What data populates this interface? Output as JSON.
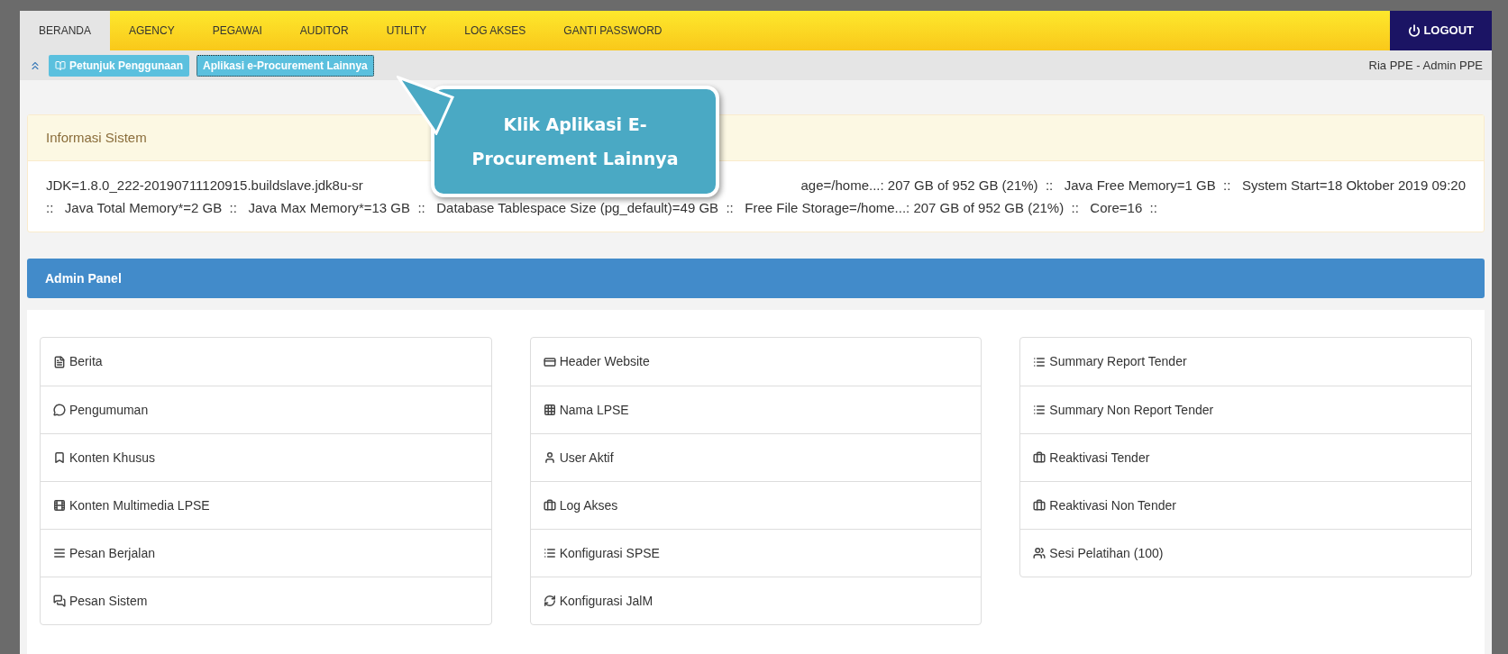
{
  "nav": {
    "tabs": [
      {
        "label": "BERANDA",
        "selected": true
      },
      {
        "label": "AGENCY",
        "selected": false
      },
      {
        "label": "PEGAWAI",
        "selected": false
      },
      {
        "label": "AUDITOR",
        "selected": false
      },
      {
        "label": "UTILITY",
        "selected": false
      },
      {
        "label": "LOG AKSES",
        "selected": false
      },
      {
        "label": "GANTI PASSWORD",
        "selected": false
      }
    ],
    "logout": "LOGOUT"
  },
  "toolbar": {
    "buttons": [
      {
        "label": "Petunjuk Penggunaan",
        "focused": false
      },
      {
        "label": "Aplikasi e-Procurement Lainnya",
        "focused": true
      }
    ],
    "user": "Ria PPE - Admin PPE"
  },
  "callout": {
    "lines": [
      "Klik Aplikasi E-",
      "Procurement Lainnya"
    ]
  },
  "info_panel": {
    "title": "Informasi Sistem",
    "line_1_start": "JDK=1.8.0_222-20190711120915.buildslave.jdk8u-sr",
    "line_1_end": "age=/home...: 207 GB of 952 GB (21%)  ::   Java Free Memory=1 GB  ::   System Start=18 Oktober 2019 09:20",
    "line_2": "::   Java Total Memory*=2 GB  ::   Java Max Memory*=13 GB  ::   Database Tablespace Size (pg_default)=49 GB  ::   Free File Storage=/home...: 207 GB of 952 GB (21%)  ::   Core=16  ::"
  },
  "admin_panel": {
    "title": "Admin Panel",
    "columns": [
      [
        "Berita",
        "Pengumuman",
        "Konten Khusus",
        "Konten Multimedia LPSE",
        "Pesan Berjalan",
        "Pesan Sistem"
      ],
      [
        "Header Website",
        "Nama LPSE",
        "User Aktif",
        "Log Akses",
        "Konfigurasi SPSE",
        "Konfigurasi JalM"
      ],
      [
        "Summary Report Tender",
        "Summary Non Report Tender",
        "Reaktivasi Tender",
        "Reaktivasi Non Tender",
        "Sesi Pelatihan (100)"
      ]
    ]
  }
}
